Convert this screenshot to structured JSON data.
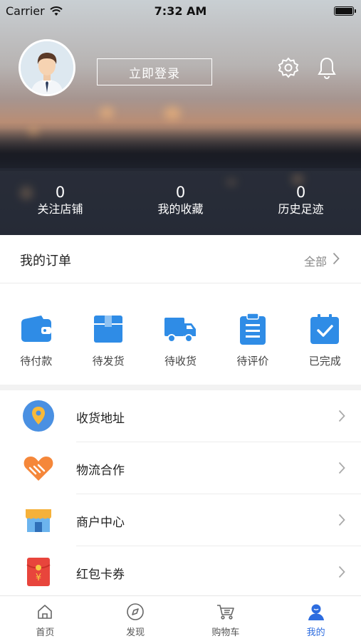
{
  "status_bar": {
    "carrier": "Carrier",
    "time": "7:32 AM"
  },
  "header": {
    "login_label": "立即登录",
    "icons": {
      "settings": "gear-icon",
      "notifications": "bell-icon"
    },
    "stats": [
      {
        "value": "0",
        "label": "关注店铺"
      },
      {
        "value": "0",
        "label": "我的收藏"
      },
      {
        "value": "0",
        "label": "历史足迹"
      }
    ]
  },
  "orders": {
    "title": "我的订单",
    "all_label": "全部",
    "items": [
      {
        "label": "待付款",
        "icon": "wallet-icon"
      },
      {
        "label": "待发货",
        "icon": "package-icon"
      },
      {
        "label": "待收货",
        "icon": "truck-icon"
      },
      {
        "label": "待评价",
        "icon": "clipboard-icon"
      },
      {
        "label": "已完成",
        "icon": "check-clipboard-icon"
      }
    ]
  },
  "menu": [
    {
      "label": "收货地址",
      "icon": "location-pin-icon"
    },
    {
      "label": "物流合作",
      "icon": "handshake-heart-icon"
    },
    {
      "label": "商户中心",
      "icon": "storefront-icon"
    },
    {
      "label": "红包卡券",
      "icon": "red-envelope-icon"
    }
  ],
  "tabbar": {
    "active": "我的",
    "items": [
      {
        "label": "首页",
        "icon": "home-icon"
      },
      {
        "label": "发现",
        "icon": "compass-icon"
      },
      {
        "label": "购物车",
        "icon": "cart-icon"
      },
      {
        "label": "我的",
        "icon": "user-icon"
      }
    ]
  },
  "colors": {
    "accent": "#2d6cdf",
    "icon_blue": "#2f8ce6",
    "orange": "#f5873a",
    "red": "#e8453c"
  }
}
